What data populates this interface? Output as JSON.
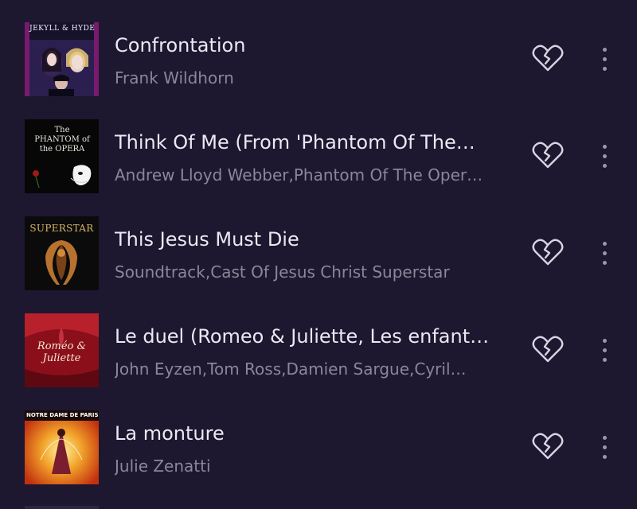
{
  "songs": [
    {
      "title": "Confrontation",
      "artist": "Frank Wildhorn",
      "cover_icon": "album-cover-jekyll-hyde",
      "cover_text": "JEKYLL & HYDE"
    },
    {
      "title": "Think Of Me (From 'Phantom Of The…",
      "artist": "Andrew Lloyd Webber,Phantom Of The Oper…",
      "cover_icon": "album-cover-phantom-of-the-opera",
      "cover_text": "The PHANTOM of the OPERA"
    },
    {
      "title": "This Jesus Must Die",
      "artist": "Soundtrack,Cast Of Jesus Christ Superstar",
      "cover_icon": "album-cover-jesus-christ-superstar",
      "cover_text": "SUPERSTAR"
    },
    {
      "title": "Le duel (Romeo & Juliette, Les enfant…",
      "artist": "John Eyzen,Tom Ross,Damien Sargue,Cyril…",
      "cover_icon": "album-cover-romeo-juliette",
      "cover_text": "Roméo & Juliette"
    },
    {
      "title": "La monture",
      "artist": "Julie Zenatti",
      "cover_icon": "album-cover-notre-dame-de-paris",
      "cover_text": "NOTRE DAME DE PARIS"
    }
  ],
  "icons": {
    "like": "broken-heart-icon",
    "more": "more-vertical-icon"
  },
  "colors": {
    "background": "#1e1730",
    "title_text": "#ece8f3",
    "subtitle_text": "#8c8698",
    "icon": "#d9d4e2"
  }
}
